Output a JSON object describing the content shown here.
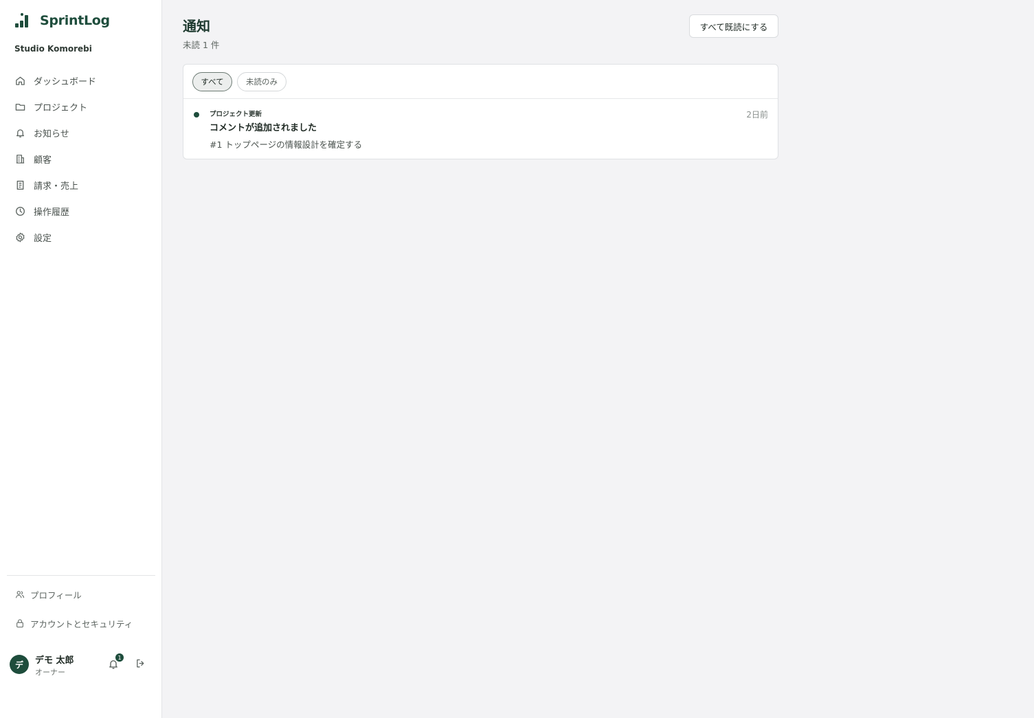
{
  "app": {
    "name": "SprintLog",
    "organization": "Studio Komorebi"
  },
  "sidebar": {
    "items": [
      {
        "label": "ダッシュボード",
        "icon": "home-icon"
      },
      {
        "label": "プロジェクト",
        "icon": "folder-icon"
      },
      {
        "label": "お知らせ",
        "icon": "bell-icon"
      },
      {
        "label": "顧客",
        "icon": "building-icon"
      },
      {
        "label": "請求・売上",
        "icon": "receipt-icon"
      },
      {
        "label": "操作履歴",
        "icon": "clock-icon"
      },
      {
        "label": "設定",
        "icon": "gear-icon"
      }
    ],
    "secondary": [
      {
        "label": "プロフィール",
        "icon": "users-icon"
      },
      {
        "label": "アカウントとセキュリティ",
        "icon": "lock-icon"
      }
    ]
  },
  "user": {
    "avatar_initial": "デ",
    "name": "デモ 太郎",
    "role": "オーナー",
    "notification_count": "1"
  },
  "page": {
    "title": "通知",
    "unread_summary": "未読 1 件",
    "mark_all_read_label": "すべて既読にする"
  },
  "filters": {
    "all_label": "すべて",
    "unread_label": "未読のみ",
    "selected": "すべて"
  },
  "notifications": [
    {
      "category": "プロジェクト更新",
      "title": "コメントが追加されました",
      "body": "#1 トップページの情報設計を確定する",
      "time": "2日前",
      "unread": true
    }
  ],
  "colors": {
    "brand": "#1e4d3c",
    "background": "#f3f3f5",
    "surface": "#ffffff",
    "border": "#dfe1e4"
  }
}
